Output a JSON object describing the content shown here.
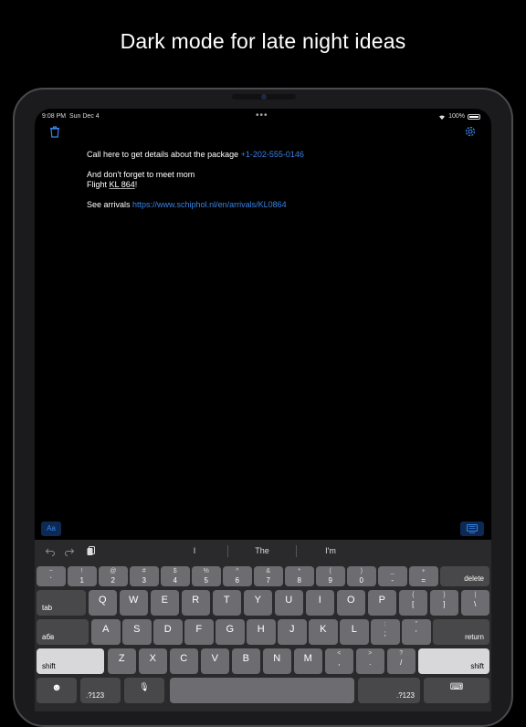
{
  "headline": "Dark mode for late night ideas",
  "status_bar": {
    "time": "9:08 PM",
    "date": "Sun Dec 4",
    "battery": "100%"
  },
  "note": {
    "line1_text": "Call here to get details about the package ",
    "line1_phone": "+1-202-555-0146",
    "line2": "And don't forget to meet mom",
    "line3_prefix": "Flight ",
    "line3_flight": "KL 864",
    "line3_suffix": "!",
    "line4_text": "See arrivals ",
    "line4_link": "https://www.schiphol.nl/en/arrivals/KL0864"
  },
  "format_button": "Aa",
  "predictions": [
    "I",
    "The",
    "I'm"
  ],
  "keyboard": {
    "row1": [
      {
        "top": "~",
        "bot": "`"
      },
      {
        "top": "!",
        "bot": "1"
      },
      {
        "top": "@",
        "bot": "2"
      },
      {
        "top": "#",
        "bot": "3"
      },
      {
        "top": "$",
        "bot": "4"
      },
      {
        "top": "%",
        "bot": "5"
      },
      {
        "top": "^",
        "bot": "6"
      },
      {
        "top": "&",
        "bot": "7"
      },
      {
        "top": "*",
        "bot": "8"
      },
      {
        "top": "(",
        "bot": "9"
      },
      {
        "top": ")",
        "bot": "0"
      },
      {
        "top": "_",
        "bot": "-"
      },
      {
        "top": "+",
        "bot": "="
      }
    ],
    "delete": "delete",
    "tab": "tab",
    "row2": [
      "Q",
      "W",
      "E",
      "R",
      "T",
      "Y",
      "U",
      "I",
      "O",
      "P"
    ],
    "row2_sym": [
      {
        "top": "{",
        "bot": "["
      },
      {
        "top": "}",
        "bot": "]"
      },
      {
        "top": "|",
        "bot": "\\"
      }
    ],
    "lang": "абв",
    "row3": [
      "A",
      "S",
      "D",
      "F",
      "G",
      "H",
      "J",
      "K",
      "L"
    ],
    "row3_sym": [
      {
        "top": ":",
        "bot": ";"
      },
      {
        "top": "\"",
        "bot": "'"
      }
    ],
    "return": "return",
    "shift": "shift",
    "row4": [
      "Z",
      "X",
      "C",
      "V",
      "B",
      "N",
      "M"
    ],
    "row4_sym": [
      {
        "top": "<",
        "bot": ","
      },
      {
        "top": ">",
        "bot": "."
      },
      {
        "top": "?",
        "bot": "/"
      }
    ],
    "numbers": ".?123"
  }
}
